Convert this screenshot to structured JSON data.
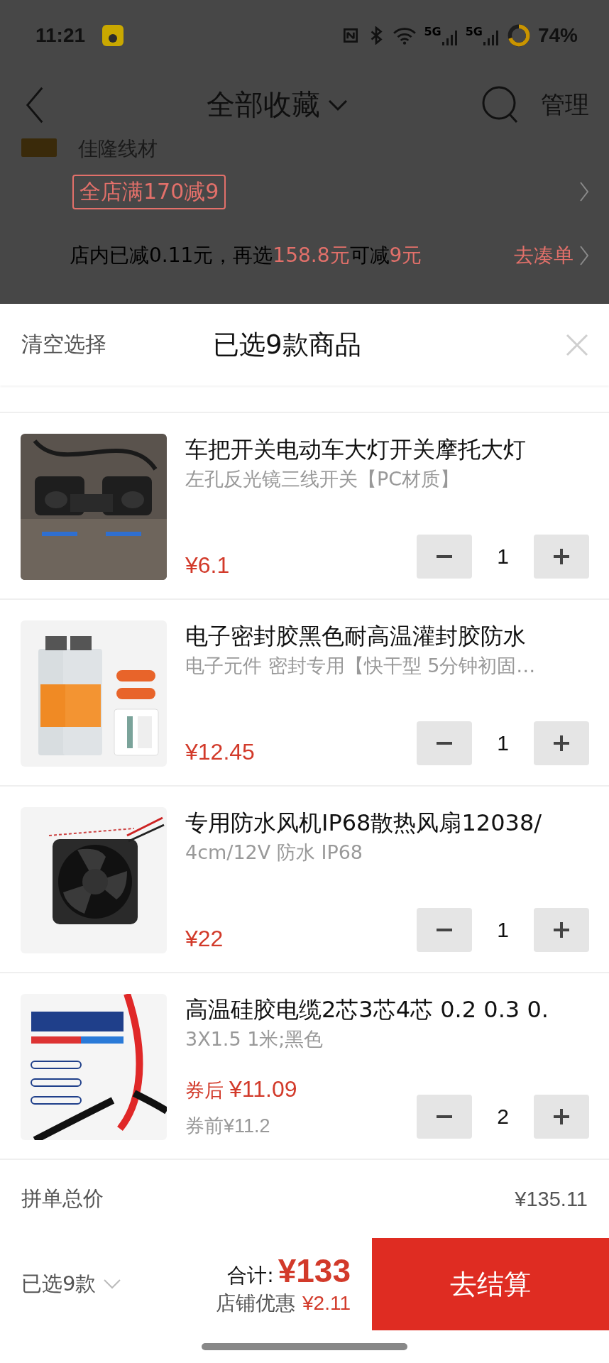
{
  "status_bar": {
    "time": "11:21",
    "signals": [
      "5G",
      "5G"
    ],
    "battery": "74%"
  },
  "nav": {
    "title": "全部收藏",
    "action": "管理"
  },
  "store": {
    "name": "佳隆线材",
    "promo": "全店满170减9",
    "notice": [
      {
        "text": "店内已减0.11元，再选",
        "highlight": false
      },
      {
        "text": "158.8元",
        "highlight": true
      },
      {
        "text": "可减",
        "highlight": false
      },
      {
        "text": "9元",
        "highlight": true
      }
    ],
    "action": "去凑单"
  },
  "sheet": {
    "clear": "清空选择",
    "title": "已选9款商品"
  },
  "items": [
    {
      "title": "车把开关电动车大灯开关摩托大灯",
      "spec": "左孔反光镜三线开关【PC材质】",
      "price": "¥6.1",
      "quantity": "1"
    },
    {
      "title": "电子密封胶黑色耐高温灌封胶防水",
      "spec": "电子元件 密封专用【快干型 5分钟初固…",
      "price": "¥12.45",
      "quantity": "1"
    },
    {
      "title": "专用防水风机IP68散热风扇12038/",
      "spec": "4cm/12V 防水 IP68",
      "price": "¥22",
      "quantity": "1"
    },
    {
      "title": "高温硅胶电缆2芯3芯4芯 0.2 0.3 0.",
      "spec": "3X1.5  1米;黑色",
      "price_prefix": "券后",
      "price": "¥11.09",
      "pre_coupon": "券前¥11.2",
      "quantity": "2"
    }
  ],
  "summary": {
    "label": "拼单总价",
    "value": "¥135.11"
  },
  "footer": {
    "selected": "已选9款",
    "total_label": "合计:",
    "total": "¥133",
    "discount_label": "店铺优惠",
    "discount": "¥2.11",
    "checkout": "去结算"
  }
}
